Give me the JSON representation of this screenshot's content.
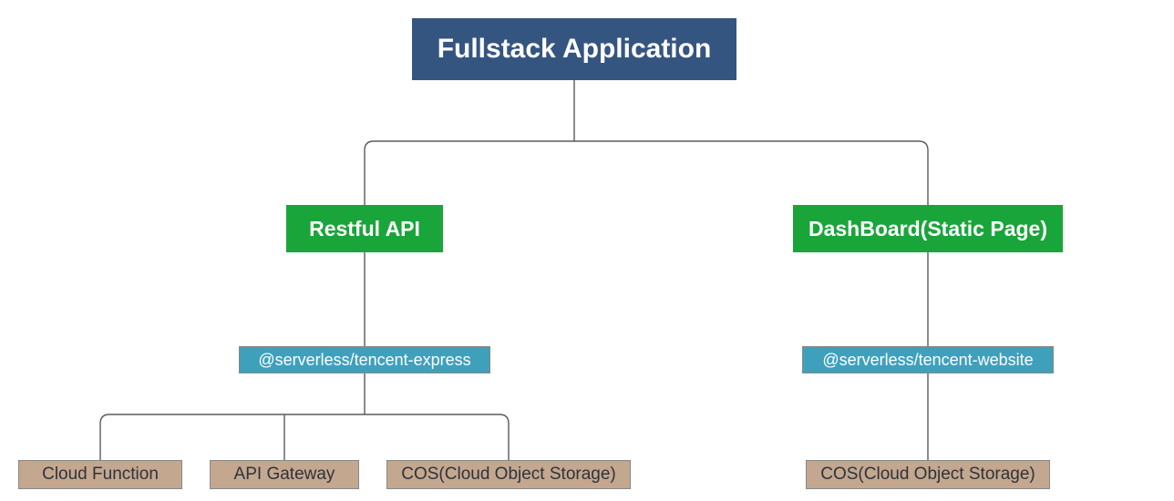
{
  "nodes": {
    "root": "Fullstack Application",
    "restful_api": "Restful API",
    "dashboard": "DashBoard(Static Page)",
    "pkg_express": "@serverless/tencent-express",
    "pkg_website": "@serverless/tencent-website",
    "cloud_function": "Cloud Function",
    "api_gateway": "API Gateway",
    "cos_left": "COS(Cloud Object Storage)",
    "cos_right": "COS(Cloud Object Storage)"
  },
  "tree": {
    "Fullstack Application": {
      "Restful API": {
        "@serverless/tencent-express": [
          "Cloud Function",
          "API Gateway",
          "COS(Cloud Object Storage)"
        ]
      },
      "DashBoard(Static Page)": {
        "@serverless/tencent-website": [
          "COS(Cloud Object Storage)"
        ]
      }
    }
  },
  "colors": {
    "root": "#355581",
    "category": "#1aa53a",
    "package": "#3fa0bc",
    "leaf": "#c4a78f",
    "line": "#5b5b5b"
  }
}
